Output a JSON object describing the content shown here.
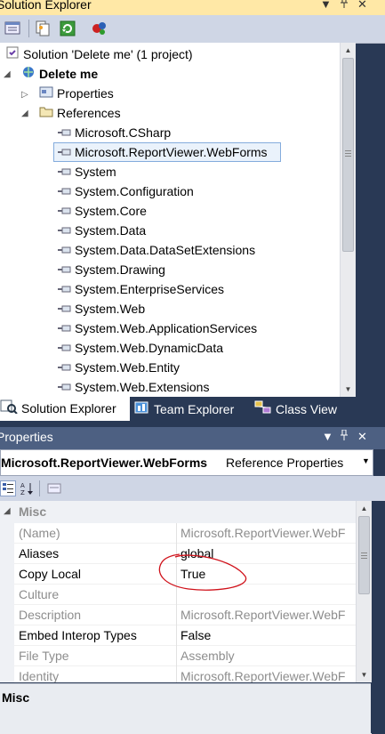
{
  "solution_explorer": {
    "title": "Solution Explorer",
    "controls": {
      "pin": "▼",
      "autohide": "ᛘ",
      "close": "✕"
    },
    "tree": {
      "solution": "Solution 'Delete me' (1 project)",
      "project": "Delete me",
      "properties": "Properties",
      "references": "References",
      "items": [
        "Microsoft.CSharp",
        "Microsoft.ReportViewer.WebForms",
        "System",
        "System.Configuration",
        "System.Core",
        "System.Data",
        "System.Data.DataSetExtensions",
        "System.Drawing",
        "System.EnterpriseServices",
        "System.Web",
        "System.Web.ApplicationServices",
        "System.Web.DynamicData",
        "System.Web.Entity",
        "System.Web.Extensions"
      ],
      "selected_index": 1
    },
    "tabs": [
      {
        "label": "Solution Explorer",
        "active": true
      },
      {
        "label": "Team Explorer",
        "active": false
      },
      {
        "label": "Class View",
        "active": false
      }
    ]
  },
  "properties": {
    "title": "Properties",
    "controls": {
      "pin": "▼",
      "autohide": "ᛘ",
      "close": "✕"
    },
    "object_name": "Microsoft.ReportViewer.WebForms",
    "object_kind": "Reference Properties",
    "category": "Misc",
    "rows": [
      {
        "name": "(Name)",
        "value": "Microsoft.ReportViewer.WebF",
        "readonly": true
      },
      {
        "name": "Aliases",
        "value": "global",
        "readonly": false
      },
      {
        "name": "Copy Local",
        "value": "True",
        "readonly": false
      },
      {
        "name": "Culture",
        "value": "",
        "readonly": true
      },
      {
        "name": "Description",
        "value": "Microsoft.ReportViewer.WebF",
        "readonly": true
      },
      {
        "name": "Embed Interop Types",
        "value": "False",
        "readonly": false
      },
      {
        "name": "File Type",
        "value": "Assembly",
        "readonly": true
      },
      {
        "name": "Identity",
        "value": "Microsoft.ReportViewer.WebF",
        "readonly": true
      }
    ],
    "description_title": "Misc"
  },
  "colors": {
    "background": "#293955",
    "title_active": "#ffe8a6",
    "title_inactive": "#4d6082",
    "selection_border": "#84acdd",
    "annotation": "#d0121b"
  }
}
